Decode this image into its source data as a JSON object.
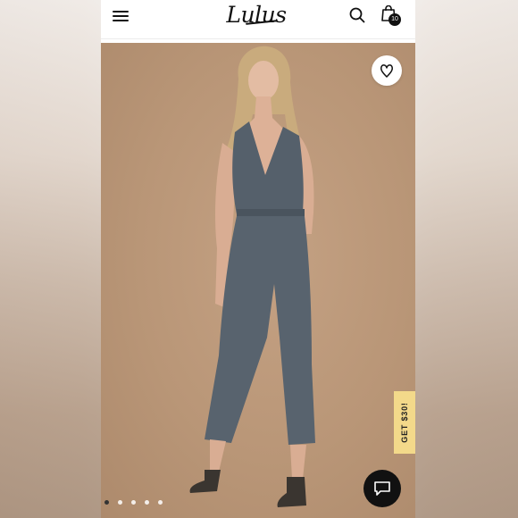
{
  "header": {
    "logo_text": "Lulus",
    "menu_icon": "hamburger-menu-icon",
    "search_icon": "search-icon",
    "bag_icon": "shopping-bag-icon",
    "bag_count": "10"
  },
  "product_image": {
    "favorite_icon": "heart-icon",
    "carousel_dots": 5,
    "active_dot": 0
  },
  "promo": {
    "label": "GET $30!"
  },
  "chat": {
    "icon": "chat-bubble-icon"
  },
  "colors": {
    "accent_promo": "#f3d98a",
    "header_bg": "#ffffff",
    "chat_bg": "#111111"
  }
}
